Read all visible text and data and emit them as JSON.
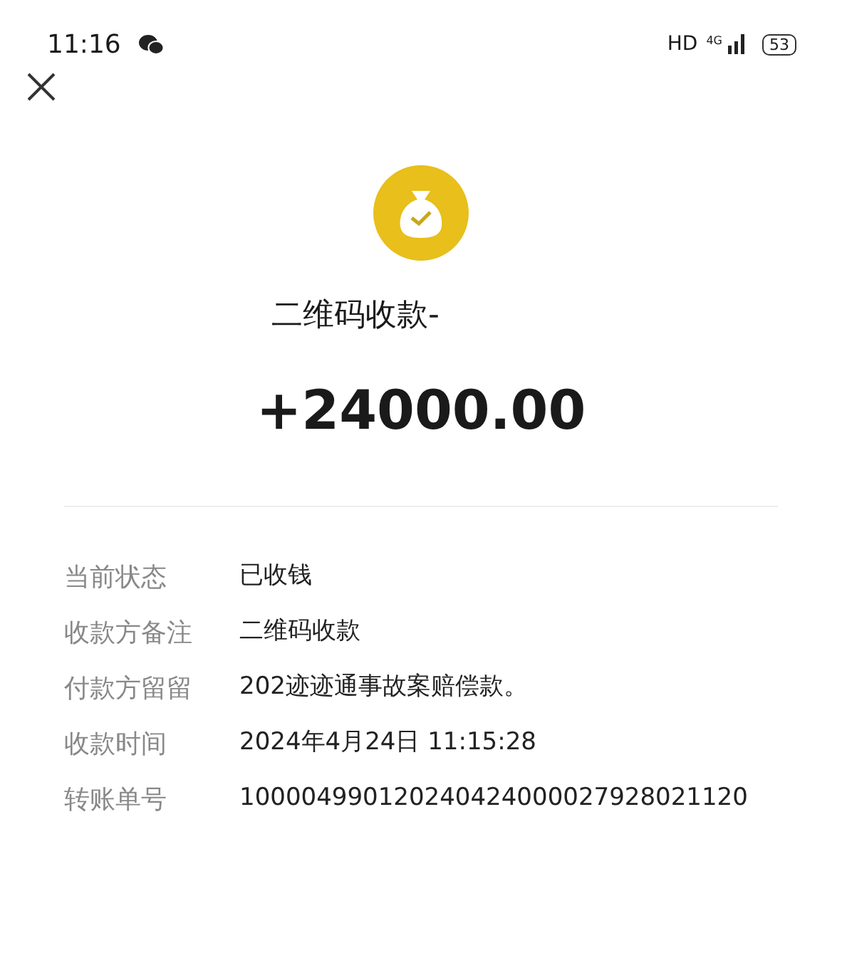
{
  "status_bar": {
    "time": "11:16",
    "network": "HD",
    "network_type": "4G",
    "battery": "53"
  },
  "title": "二维码收款-",
  "amount": "+24000.00",
  "details": [
    {
      "label": "当前状态",
      "value": "已收钱"
    },
    {
      "label": "收款方备注",
      "value": "二维码收款"
    },
    {
      "label": "付款方留留",
      "value": "202迹迹通事故案赔偿款。"
    },
    {
      "label": "收款时间",
      "value": "2024年4月24日 11:15:28"
    },
    {
      "label": "转账单号",
      "value": "100004990120240424000027928021120"
    }
  ]
}
